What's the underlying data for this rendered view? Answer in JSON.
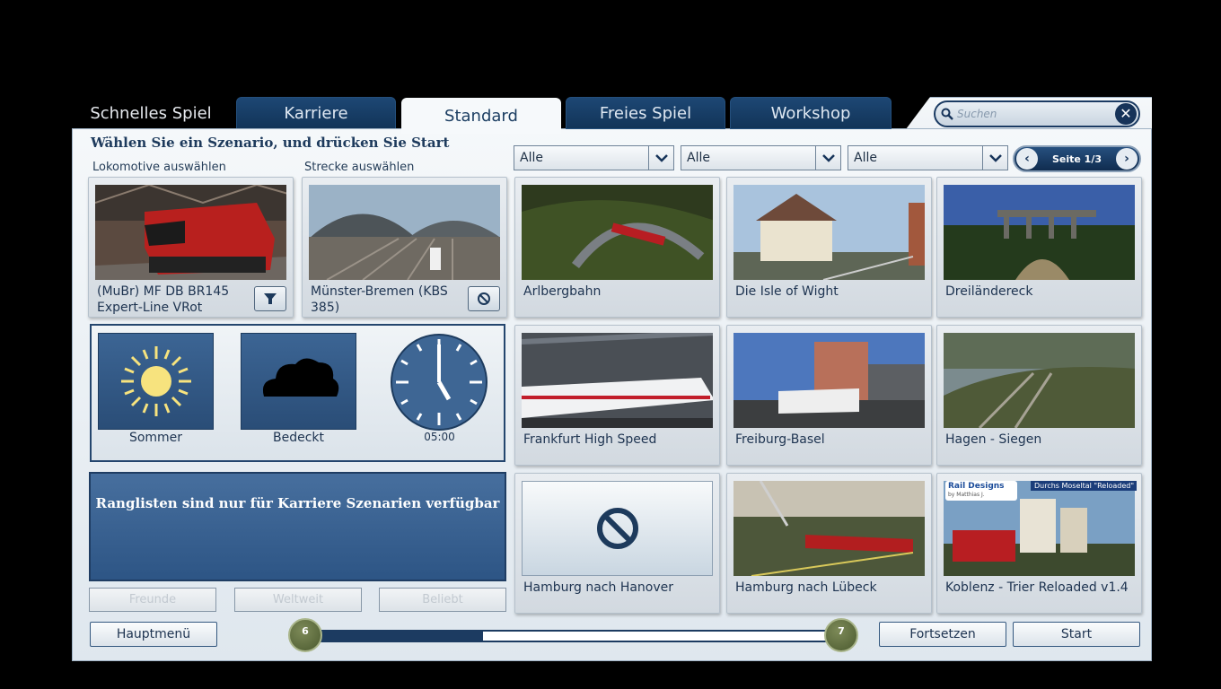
{
  "tabs": [
    {
      "label": "Schnelles Spiel"
    },
    {
      "label": "Karriere"
    },
    {
      "label": "Standard"
    },
    {
      "label": "Freies Spiel"
    },
    {
      "label": "Workshop"
    }
  ],
  "search": {
    "placeholder": "Suchen"
  },
  "instruction": "Wählen Sie ein Szenario, und drücken Sie Start",
  "loco_label": "Lokomotive auswählen",
  "route_label": "Strecke auswählen",
  "loco": {
    "name_line1": "(MuBr) MF DB BR145",
    "name_line2": "Expert-Line VRot"
  },
  "route": {
    "name_line1": "Münster-Bremen (KBS",
    "name_line2": "385)"
  },
  "filters": [
    "Alle",
    "Alle",
    "Alle"
  ],
  "pager": {
    "label": "Seite 1/3"
  },
  "conditions": {
    "season": "Sommer",
    "weather": "Bedeckt",
    "time": "05:00"
  },
  "leaderboard": {
    "message": "Ranglisten sind nur für Karriere Szenarien verfügbar"
  },
  "leader_buttons": [
    "Freunde",
    "Weltweit",
    "Beliebt"
  ],
  "scenarios": [
    {
      "title": "Arlbergbahn"
    },
    {
      "title": "Die Isle of Wight"
    },
    {
      "title": "Dreiländereck"
    },
    {
      "title": "Frankfurt High Speed"
    },
    {
      "title": "Freiburg-Basel"
    },
    {
      "title": "Hagen - Siegen"
    },
    {
      "title": "Hamburg nach Hanover"
    },
    {
      "title": "Hamburg nach Lübeck"
    },
    {
      "title": "Koblenz - Trier Reloaded v1.4"
    }
  ],
  "koblenz_banner": {
    "brand": "Rail Designs",
    "by": "by Matthias J.",
    "tag": "Durchs Moseltal \"Reloaded\""
  },
  "bottom": {
    "main_menu": "Hauptmenü",
    "continue": "Fortsetzen",
    "start": "Start"
  },
  "slider": {
    "min_label": "6",
    "max_label": "7",
    "fill_fraction": 0.33
  },
  "colors": {
    "accent": "#1c3b61",
    "panel": "#f5f8fa",
    "tab_dark": "#1d4774"
  }
}
